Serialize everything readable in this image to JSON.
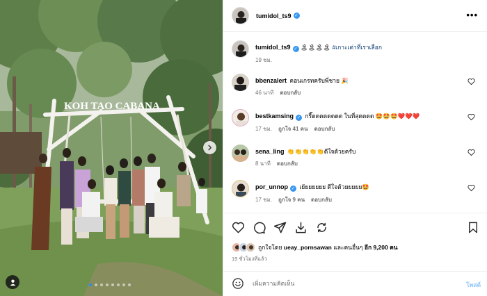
{
  "photo": {
    "sign_text": "KOH TAO CABANA",
    "next_label": "›",
    "slide_count": 8,
    "active_slide": 1
  },
  "header": {
    "username": "tumidol_ts9",
    "verified_mark": "✓",
    "more_label": "•••"
  },
  "caption": {
    "username": "tumidol_ts9",
    "emoji_text": "🏝🏝🏝🏝",
    "hashtag": "#เกาะเต่าที่เราเลือก",
    "time": "19 ชม."
  },
  "comments": [
    {
      "username": "bbenzalert",
      "verified": false,
      "text": "คอนเกรทครับพี่ชาย 🎉",
      "time": "46 นาที",
      "likes": "",
      "reply": "ตอบกลับ"
    },
    {
      "username": "bestkamsing",
      "verified": true,
      "text": "กรี๊ดดดดดดดด ในที่สุดดดด 🤩🤩🤩❤️❤️❤️",
      "time": "17 ชม.",
      "likes": "ถูกใจ 41 คน",
      "reply": "ตอบกลับ"
    },
    {
      "username": "sena_ling",
      "verified": false,
      "text": "👏👏👏👏👏ดีใจด้วยครับ",
      "time": "8 นาที",
      "likes": "",
      "reply": "ตอบกลับ"
    },
    {
      "username": "por_unnop",
      "verified": true,
      "text": "เย้ยยยยยย ดีใจด้วยยยยย🤩",
      "time": "17 ชม.",
      "likes": "ถูกใจ 9 คน",
      "reply": "ตอบกลับ"
    }
  ],
  "likes": {
    "prefix": "ถูกใจโดย",
    "user": "ueay_pornsawan",
    "middle": "และคนอื่นๆ",
    "count": "อีก 9,200 คน"
  },
  "posted_ago": "19 ชั่วโมงที่แล้ว",
  "composer": {
    "placeholder": "เพิ่มความคิดเห็น",
    "post_label": "โพสต์"
  },
  "colors": {
    "verified": "#3897f0",
    "link": "#00376b",
    "post_button": "#8fc5f9",
    "active_dot": "#2d8cf0"
  }
}
